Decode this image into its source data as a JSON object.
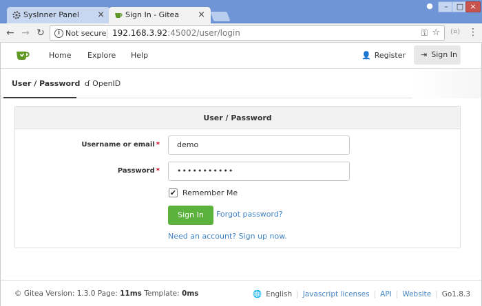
{
  "browser": {
    "tabs": [
      {
        "title": "SysInner Panel",
        "active": false
      },
      {
        "title": "Sign In - Gitea",
        "active": true
      }
    ],
    "security_label": "Not secure",
    "url_host": "192.168.3.92",
    "url_rest": ":45002/user/login"
  },
  "nav": {
    "home": "Home",
    "explore": "Explore",
    "help": "Help",
    "register": "Register",
    "signin": "Sign In"
  },
  "auth_tabs": {
    "userpass": "User / Password",
    "openid": "OpenID"
  },
  "form": {
    "header": "User / Password",
    "username_label": "Username or email",
    "username_value": "demo",
    "password_label": "Password",
    "password_mask": "•••••••••••",
    "remember_label": "Remember Me",
    "remember_checked": true,
    "signin_button": "Sign In",
    "forgot_link": "Forgot password?",
    "signup_link": "Need an account? Sign up now."
  },
  "footer": {
    "version_text": "© Gitea Version: 1.3.0 Page: ",
    "page_time": "11ms",
    "template_text": " Template: ",
    "template_time": "0ms",
    "language": "English",
    "js_licenses": "Javascript licenses",
    "api": "API",
    "website": "Website",
    "go_version": "Go1.8.3"
  },
  "colors": {
    "titlebar": "#6f95d6",
    "primary_button": "#5bb33e",
    "link": "#4183c4",
    "required": "#d0021b"
  }
}
